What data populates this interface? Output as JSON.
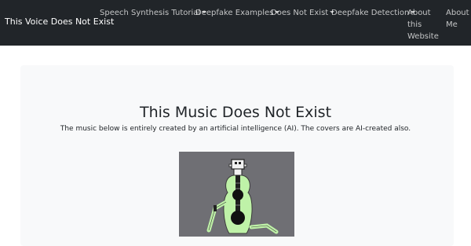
{
  "navbar": {
    "brand": "This Voice Does Not Exist",
    "items": [
      {
        "label": "Speech Synthesis Tutorial",
        "dropdown": true
      },
      {
        "label": "Deepfake Examples",
        "dropdown": true
      },
      {
        "label": "Does Not Exist",
        "dropdown": true
      },
      {
        "label": "Deepfake Detection",
        "dropdown": true
      }
    ],
    "about_website": [
      "About",
      "this",
      "Website"
    ],
    "about_me": [
      "About",
      "Me"
    ]
  },
  "main": {
    "title": "This Music Does Not Exist",
    "description": "The music below is entirely created by an artificial intelligence (AI). The covers are AI-created also."
  },
  "colors": {
    "navbar_bg": "#212529",
    "jumbotron_bg": "#f8f9fa",
    "cover_bg": "#6f6f74",
    "figure_green": "#bff2a8"
  },
  "icons": {
    "caret": "chevron-down-icon"
  }
}
